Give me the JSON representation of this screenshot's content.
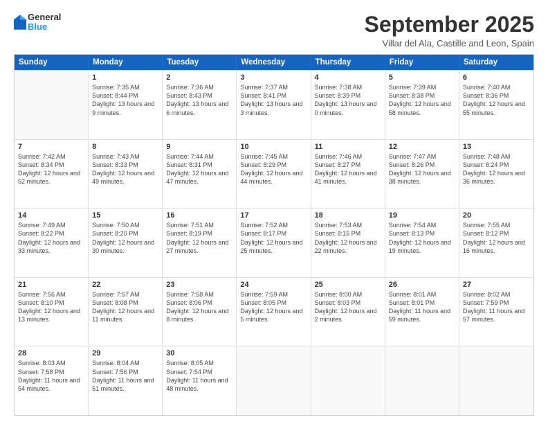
{
  "logo": {
    "general": "General",
    "blue": "Blue"
  },
  "header": {
    "month": "September 2025",
    "location": "Villar del Ala, Castille and Leon, Spain"
  },
  "weekdays": [
    "Sunday",
    "Monday",
    "Tuesday",
    "Wednesday",
    "Thursday",
    "Friday",
    "Saturday"
  ],
  "weeks": [
    [
      {
        "day": "",
        "sunrise": "",
        "sunset": "",
        "daylight": ""
      },
      {
        "day": "1",
        "sunrise": "Sunrise: 7:35 AM",
        "sunset": "Sunset: 8:44 PM",
        "daylight": "Daylight: 13 hours and 9 minutes."
      },
      {
        "day": "2",
        "sunrise": "Sunrise: 7:36 AM",
        "sunset": "Sunset: 8:43 PM",
        "daylight": "Daylight: 13 hours and 6 minutes."
      },
      {
        "day": "3",
        "sunrise": "Sunrise: 7:37 AM",
        "sunset": "Sunset: 8:41 PM",
        "daylight": "Daylight: 13 hours and 3 minutes."
      },
      {
        "day": "4",
        "sunrise": "Sunrise: 7:38 AM",
        "sunset": "Sunset: 8:39 PM",
        "daylight": "Daylight: 13 hours and 0 minutes."
      },
      {
        "day": "5",
        "sunrise": "Sunrise: 7:39 AM",
        "sunset": "Sunset: 8:38 PM",
        "daylight": "Daylight: 12 hours and 58 minutes."
      },
      {
        "day": "6",
        "sunrise": "Sunrise: 7:40 AM",
        "sunset": "Sunset: 8:36 PM",
        "daylight": "Daylight: 12 hours and 55 minutes."
      }
    ],
    [
      {
        "day": "7",
        "sunrise": "Sunrise: 7:42 AM",
        "sunset": "Sunset: 8:34 PM",
        "daylight": "Daylight: 12 hours and 52 minutes."
      },
      {
        "day": "8",
        "sunrise": "Sunrise: 7:43 AM",
        "sunset": "Sunset: 8:33 PM",
        "daylight": "Daylight: 12 hours and 49 minutes."
      },
      {
        "day": "9",
        "sunrise": "Sunrise: 7:44 AM",
        "sunset": "Sunset: 8:31 PM",
        "daylight": "Daylight: 12 hours and 47 minutes."
      },
      {
        "day": "10",
        "sunrise": "Sunrise: 7:45 AM",
        "sunset": "Sunset: 8:29 PM",
        "daylight": "Daylight: 12 hours and 44 minutes."
      },
      {
        "day": "11",
        "sunrise": "Sunrise: 7:46 AM",
        "sunset": "Sunset: 8:27 PM",
        "daylight": "Daylight: 12 hours and 41 minutes."
      },
      {
        "day": "12",
        "sunrise": "Sunrise: 7:47 AM",
        "sunset": "Sunset: 8:26 PM",
        "daylight": "Daylight: 12 hours and 38 minutes."
      },
      {
        "day": "13",
        "sunrise": "Sunrise: 7:48 AM",
        "sunset": "Sunset: 8:24 PM",
        "daylight": "Daylight: 12 hours and 36 minutes."
      }
    ],
    [
      {
        "day": "14",
        "sunrise": "Sunrise: 7:49 AM",
        "sunset": "Sunset: 8:22 PM",
        "daylight": "Daylight: 12 hours and 33 minutes."
      },
      {
        "day": "15",
        "sunrise": "Sunrise: 7:50 AM",
        "sunset": "Sunset: 8:20 PM",
        "daylight": "Daylight: 12 hours and 30 minutes."
      },
      {
        "day": "16",
        "sunrise": "Sunrise: 7:51 AM",
        "sunset": "Sunset: 8:19 PM",
        "daylight": "Daylight: 12 hours and 27 minutes."
      },
      {
        "day": "17",
        "sunrise": "Sunrise: 7:52 AM",
        "sunset": "Sunset: 8:17 PM",
        "daylight": "Daylight: 12 hours and 25 minutes."
      },
      {
        "day": "18",
        "sunrise": "Sunrise: 7:53 AM",
        "sunset": "Sunset: 8:15 PM",
        "daylight": "Daylight: 12 hours and 22 minutes."
      },
      {
        "day": "19",
        "sunrise": "Sunrise: 7:54 AM",
        "sunset": "Sunset: 8:13 PM",
        "daylight": "Daylight: 12 hours and 19 minutes."
      },
      {
        "day": "20",
        "sunrise": "Sunrise: 7:55 AM",
        "sunset": "Sunset: 8:12 PM",
        "daylight": "Daylight: 12 hours and 16 minutes."
      }
    ],
    [
      {
        "day": "21",
        "sunrise": "Sunrise: 7:56 AM",
        "sunset": "Sunset: 8:10 PM",
        "daylight": "Daylight: 12 hours and 13 minutes."
      },
      {
        "day": "22",
        "sunrise": "Sunrise: 7:57 AM",
        "sunset": "Sunset: 8:08 PM",
        "daylight": "Daylight: 12 hours and 11 minutes."
      },
      {
        "day": "23",
        "sunrise": "Sunrise: 7:58 AM",
        "sunset": "Sunset: 8:06 PM",
        "daylight": "Daylight: 12 hours and 8 minutes."
      },
      {
        "day": "24",
        "sunrise": "Sunrise: 7:59 AM",
        "sunset": "Sunset: 8:05 PM",
        "daylight": "Daylight: 12 hours and 5 minutes."
      },
      {
        "day": "25",
        "sunrise": "Sunrise: 8:00 AM",
        "sunset": "Sunset: 8:03 PM",
        "daylight": "Daylight: 12 hours and 2 minutes."
      },
      {
        "day": "26",
        "sunrise": "Sunrise: 8:01 AM",
        "sunset": "Sunset: 8:01 PM",
        "daylight": "Daylight: 11 hours and 59 minutes."
      },
      {
        "day": "27",
        "sunrise": "Sunrise: 8:02 AM",
        "sunset": "Sunset: 7:59 PM",
        "daylight": "Daylight: 11 hours and 57 minutes."
      }
    ],
    [
      {
        "day": "28",
        "sunrise": "Sunrise: 8:03 AM",
        "sunset": "Sunset: 7:58 PM",
        "daylight": "Daylight: 11 hours and 54 minutes."
      },
      {
        "day": "29",
        "sunrise": "Sunrise: 8:04 AM",
        "sunset": "Sunset: 7:56 PM",
        "daylight": "Daylight: 11 hours and 51 minutes."
      },
      {
        "day": "30",
        "sunrise": "Sunrise: 8:05 AM",
        "sunset": "Sunset: 7:54 PM",
        "daylight": "Daylight: 11 hours and 48 minutes."
      },
      {
        "day": "",
        "sunrise": "",
        "sunset": "",
        "daylight": ""
      },
      {
        "day": "",
        "sunrise": "",
        "sunset": "",
        "daylight": ""
      },
      {
        "day": "",
        "sunrise": "",
        "sunset": "",
        "daylight": ""
      },
      {
        "day": "",
        "sunrise": "",
        "sunset": "",
        "daylight": ""
      }
    ]
  ]
}
